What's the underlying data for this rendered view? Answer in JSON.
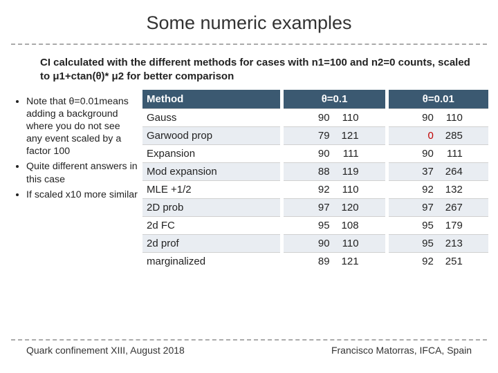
{
  "title": "Some numeric examples",
  "caption": "CI calculated with the different methods for cases with n1=100 and n2=0 counts, scaled to μ1+ctan(θ)* μ2 for better comparison",
  "notes": {
    "items": [
      "Note that θ=0.01means adding a background where you do not see any event scaled by a factor 100",
      "Quite different answers in this case",
      "If scaled x10 more similar"
    ]
  },
  "table": {
    "headers": [
      "Method",
      "θ=0.1",
      "θ=0.01"
    ],
    "rows": [
      {
        "method": "Gauss",
        "c1a": "90",
        "c1b": "110",
        "c2a": "90",
        "c2b": "110",
        "red_c2a": false
      },
      {
        "method": "Garwood prop",
        "c1a": "79",
        "c1b": "121",
        "c2a": "0",
        "c2b": "285",
        "red_c2a": true
      },
      {
        "method": "Expansion",
        "c1a": "90",
        "c1b": "111",
        "c2a": "90",
        "c2b": "111",
        "red_c2a": false
      },
      {
        "method": "Mod expansion",
        "c1a": "88",
        "c1b": "119",
        "c2a": "37",
        "c2b": "264",
        "red_c2a": false
      },
      {
        "method": "MLE +1/2",
        "c1a": "92",
        "c1b": "110",
        "c2a": "92",
        "c2b": "132",
        "red_c2a": false
      },
      {
        "method": "2D prob",
        "c1a": "97",
        "c1b": "120",
        "c2a": "97",
        "c2b": "267",
        "red_c2a": false
      },
      {
        "method": "2d FC",
        "c1a": "95",
        "c1b": "108",
        "c2a": "95",
        "c2b": "179",
        "red_c2a": false
      },
      {
        "method": "2d prof",
        "c1a": "90",
        "c1b": "110",
        "c2a": "95",
        "c2b": "213",
        "red_c2a": false
      },
      {
        "method": "marginalized",
        "c1a": "89",
        "c1b": "121",
        "c2a": "92",
        "c2b": "251",
        "red_c2a": false
      }
    ]
  },
  "footer": {
    "left": "Quark confinement XIII, August 2018",
    "right": "Francisco Matorras, IFCA, Spain"
  }
}
